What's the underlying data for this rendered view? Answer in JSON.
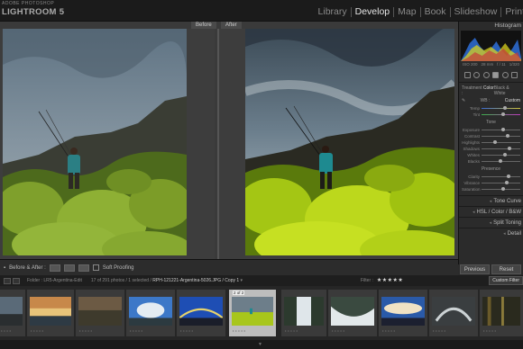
{
  "app": {
    "brand_small": "ADOBE PHOTOSHOP",
    "brand_name": "LIGHTROOM 5"
  },
  "modules": [
    "Library",
    "Develop",
    "Map",
    "Book",
    "Slideshow",
    "Print"
  ],
  "active_module": "Develop",
  "view": {
    "before_label": "Before",
    "after_label": "After"
  },
  "right_panel": {
    "header": "Histogram",
    "histo_info": [
      "ISO 200",
      "28 mm",
      "f / 11",
      "1/320"
    ],
    "treatment_label": "Treatment :",
    "treatment_color": "Color",
    "treatment_bw": "Black & White",
    "wb_label": "WB :",
    "wb_value": "Custom",
    "temp_label": "Temp",
    "tint_label": "Tint",
    "tone_title": "Tone",
    "tone_sliders": [
      "Exposure",
      "Contrast",
      "Highlights",
      "Shadows",
      "Whites",
      "Blacks"
    ],
    "presence_title": "Presence",
    "presence_sliders": [
      "Clarity",
      "Vibrance",
      "Saturation"
    ],
    "collapsed": [
      "Tone Curve",
      "HSL / Color / B&W",
      "Split Toning",
      "Detail"
    ],
    "previous_btn": "Previous",
    "reset_btn": "Reset (Adobe)"
  },
  "toolbar": {
    "mode_label": "Before & After :",
    "soft_proofing": "Soft Proofing"
  },
  "filmbar": {
    "folder": "Folder : LR5-Argentina-Edit",
    "count": "17 of 291 photos / 1 selected /",
    "filename": "RPH-121221-Argentina-5026.JPG / Copy 1",
    "filter_label": "Filter :",
    "stars": "★★★★★",
    "custom_filter": "Custom Filter"
  },
  "filmstrip": {
    "selected_badge": "2 of 2",
    "rating_dots": "• • • • •"
  },
  "colors": {
    "accent": "#d9d9d9",
    "panel_bg": "#2b2b2b",
    "foliage_before": "#7fa02c",
    "foliage_after": "#b8d41a"
  }
}
